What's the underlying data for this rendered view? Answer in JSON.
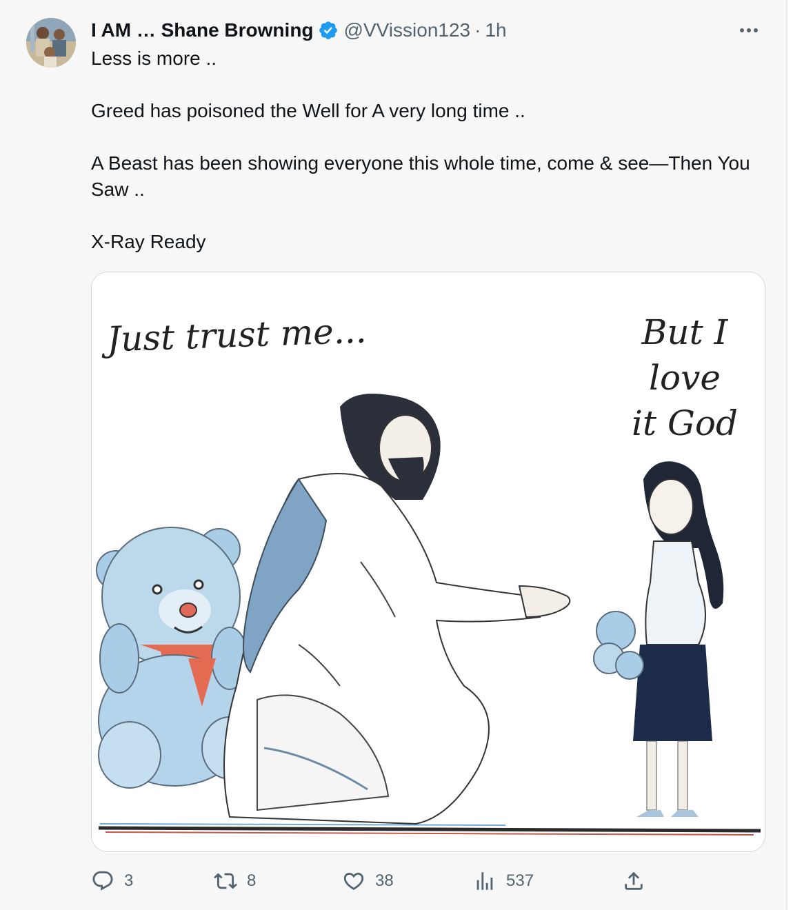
{
  "author": {
    "display_name": "I AM … Shane Browning",
    "handle": "@VVission123",
    "separator": "·",
    "time": "1h"
  },
  "tweet": {
    "lines": [
      "Less is more ..",
      "",
      "Greed has poisoned the Well for A very long time ..",
      "",
      "A Beast has been showing everyone this whole time, come & see—Then You Saw ..",
      "",
      "X-Ray Ready"
    ]
  },
  "media": {
    "left_caption": "Just trust me...",
    "right_caption_line1": "But I love",
    "right_caption_line2": "it God"
  },
  "actions": {
    "replies": "3",
    "retweets": "8",
    "likes": "38",
    "views": "537"
  },
  "icons": {
    "avatar": "avatar-photo",
    "verified": "verified-badge-icon",
    "more": "more-icon",
    "reply": "reply-icon",
    "retweet": "retweet-icon",
    "like": "heart-icon",
    "views": "views-icon",
    "share": "share-icon"
  },
  "colors": {
    "verified_blue": "#1d9bf0",
    "secondary_text": "#536471",
    "primary_text": "#0f1419"
  }
}
